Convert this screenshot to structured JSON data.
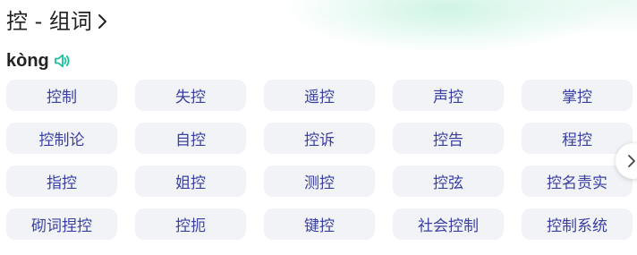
{
  "header": {
    "title": "控 - 组词",
    "chevron_icon": "chevron-right-icon"
  },
  "pinyin": {
    "text": "kòng",
    "audio_icon": "speaker-icon",
    "accent_color": "#1fbf9a"
  },
  "words": [
    "控制",
    "失控",
    "遥控",
    "声控",
    "掌控",
    "控制论",
    "自控",
    "控诉",
    "控告",
    "程控",
    "指控",
    "姐控",
    "测控",
    "控弦",
    "控名责实",
    "砌词捏控",
    "控扼",
    "键控",
    "社会控制",
    "控制系统"
  ],
  "pager": {
    "next_icon": "chevron-right-icon"
  },
  "colors": {
    "chip_bg": "#f1f3f6",
    "chip_text": "#3a3fa3",
    "title_text": "#222222"
  }
}
